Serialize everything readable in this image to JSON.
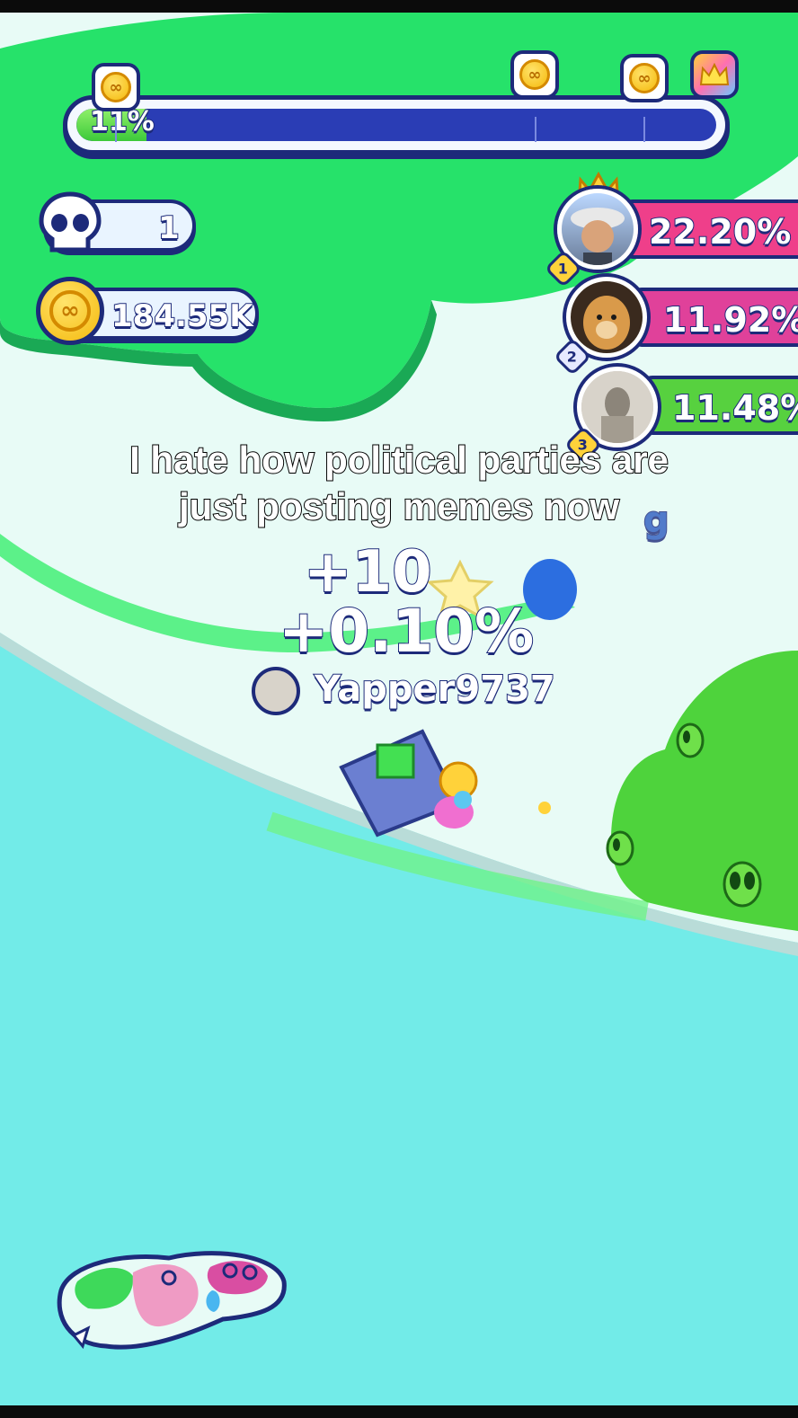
{
  "progress": {
    "value_label": "11%",
    "fill_fraction": 0.11,
    "milestone_markers": [
      "coin-icon",
      "coin-icon",
      "coin-icon",
      "crown-icon"
    ]
  },
  "stats": {
    "kills_icon": "skull-icon",
    "kills": "1",
    "coins_icon": "coin-icon",
    "coins": "184.55K"
  },
  "leaderboard": [
    {
      "rank": "1",
      "percent": "22.20%",
      "color": "#ef3f8a",
      "avatar": "player-photo-hat"
    },
    {
      "rank": "2",
      "percent": "11.92%",
      "color": "#e0419a",
      "avatar": "player-photo-dog"
    },
    {
      "rank": "3",
      "percent": "11.48%",
      "color": "#57d13f",
      "avatar": "player-photo-statue"
    }
  ],
  "caption": {
    "line1": "I hate how political parties are",
    "line2": "just posting memes now"
  },
  "game_popups": {
    "score_gain": "+10",
    "territory_gain": "+0.10%",
    "player_name": "Yapper9737",
    "other_player_partial": "g"
  },
  "colors": {
    "ocean": "#72ebe8",
    "territory_green": "#26e26a",
    "neutral_land": "#e8fbf6",
    "outline": "#1d2a7a"
  }
}
